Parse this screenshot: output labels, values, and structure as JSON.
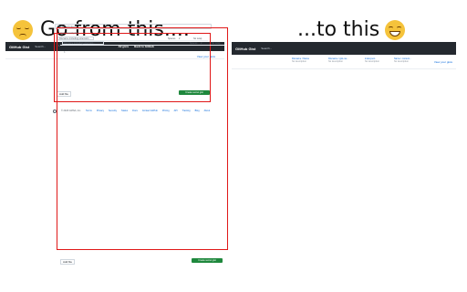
{
  "captions": {
    "before": "Go from this....",
    "after": "...to this"
  },
  "emoji": {
    "before": "pensive-face",
    "after": "grinning-face"
  },
  "colors": {
    "highlight": "#e01818",
    "header_bg": "#24292f",
    "primary_button": "#1f883d",
    "link": "#0969da"
  },
  "before_screen": {
    "logo": "GitHub Gist",
    "search": "Search...",
    "nav": [
      "All gists",
      "Back to GitHub"
    ],
    "view_gists": "View your gists",
    "description_placeholder": "Gist description...",
    "filename_placeholder": "Filename including extension...",
    "indent_mode": "Spaces",
    "indent_size": "2",
    "wrap_mode": "No wrap",
    "line_number": "1",
    "add_file": "Add file",
    "create_button": "Create secret gist",
    "footer_links": [
      "© 2023 GitHub, Inc.",
      "Terms",
      "Privacy",
      "Security",
      "Status",
      "Docs",
      "Contact GitHub",
      "Pricing",
      "API",
      "Training",
      "Blog",
      "About"
    ]
  },
  "after_screen": {
    "logo": "GitHub Gist",
    "search": "Search...",
    "recent_gists": [
      {
        "title": "Filename / Name",
        "sub": "No description"
      },
      {
        "title": "Filename / gist-na...",
        "sub": "No description"
      },
      {
        "title": "index.json",
        "sub": "No description"
      },
      {
        "title": "Name / content...",
        "sub": "No description"
      }
    ],
    "view_gists": "View your gists",
    "description_placeholder": "Gist description...",
    "filename_placeholder": "Filename including extension...",
    "indent_mode": "Spaces",
    "indent_size": "2",
    "wrap_mode": "No wrap",
    "line_number": "1",
    "add_file": "Add file",
    "create_button": "Create secret gist"
  }
}
